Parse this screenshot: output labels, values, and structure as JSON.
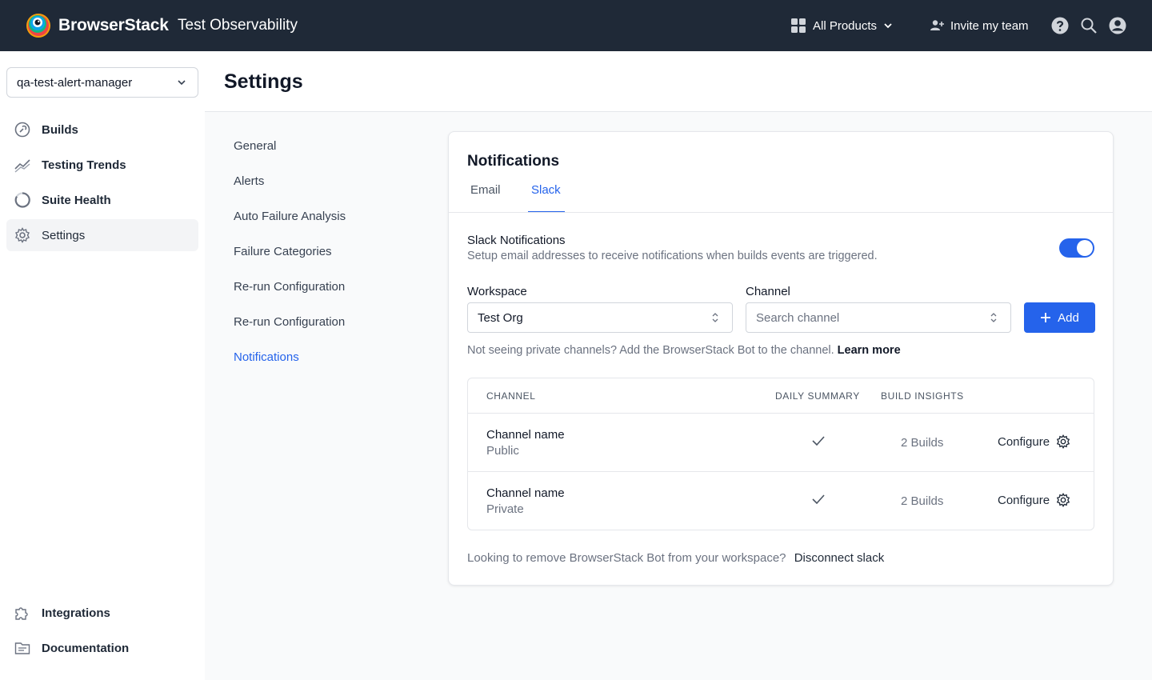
{
  "topbar": {
    "brand": "BrowserStack",
    "product": "Test Observability",
    "all_products": "All Products",
    "invite": "Invite my team"
  },
  "sidebar": {
    "project": "qa-test-alert-manager",
    "items": [
      {
        "label": "Builds",
        "icon": "builds-icon"
      },
      {
        "label": "Testing Trends",
        "icon": "trends-icon"
      },
      {
        "label": "Suite Health",
        "icon": "suite-health-icon"
      },
      {
        "label": "Settings",
        "icon": "gear-icon",
        "active": true
      }
    ],
    "bottom_items": [
      {
        "label": "Integrations",
        "icon": "puzzle-icon"
      },
      {
        "label": "Documentation",
        "icon": "folder-icon"
      }
    ]
  },
  "page": {
    "title": "Settings"
  },
  "settings_nav": [
    {
      "label": "General"
    },
    {
      "label": "Alerts"
    },
    {
      "label": "Auto Failure Analysis"
    },
    {
      "label": "Failure Categories"
    },
    {
      "label": "Re-run Configuration"
    },
    {
      "label": "Re-run Configuration"
    },
    {
      "label": "Notifications",
      "active": true
    }
  ],
  "card": {
    "title": "Notifications",
    "tabs": [
      {
        "label": "Email"
      },
      {
        "label": "Slack",
        "active": true
      }
    ],
    "slack": {
      "title": "Slack Notifications",
      "description": "Setup email addresses to receive notifications when builds events are triggered.",
      "enabled": true,
      "workspace_label": "Workspace",
      "workspace_value": "Test Org",
      "channel_label": "Channel",
      "channel_placeholder": "Search channel",
      "add_label": "Add",
      "hint": "Not seeing private channels? Add the BrowserStack Bot to the channel.",
      "hint_link": "Learn more"
    },
    "table": {
      "headers": [
        "CHANNEL",
        "DAILY SUMMARY",
        "BUILD INSIGHTS"
      ],
      "rows": [
        {
          "name": "Channel name",
          "type": "Public",
          "daily_summary": true,
          "build_insights": "2 Builds",
          "action": "Configure"
        },
        {
          "name": "Channel name",
          "type": "Private",
          "daily_summary": true,
          "build_insights": "2 Builds",
          "action": "Configure"
        }
      ]
    },
    "footer": {
      "text": "Looking to remove BrowserStack Bot from your workspace?",
      "link": "Disconnect slack"
    }
  },
  "colors": {
    "topbar": "#1f2937",
    "accent": "#2563eb"
  }
}
